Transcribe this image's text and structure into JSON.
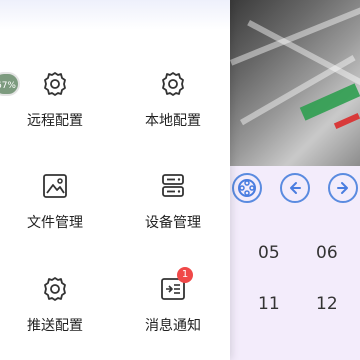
{
  "menu": {
    "items": [
      {
        "label": "远程配置",
        "icon": "gear-icon"
      },
      {
        "label": "本地配置",
        "icon": "gear-icon"
      },
      {
        "label": "文件管理",
        "icon": "image-file-icon"
      },
      {
        "label": "设备管理",
        "icon": "server-icon"
      },
      {
        "label": "推送配置",
        "icon": "gear-icon"
      },
      {
        "label": "消息通知",
        "icon": "message-icon",
        "badge": "1"
      }
    ],
    "avatar_badge": "67%"
  },
  "playback": {
    "channels": [
      "05",
      "06",
      "11",
      "12"
    ]
  },
  "colors": {
    "accent": "#4a7de0",
    "badge": "#f04848",
    "panel_bg": "#ffffff"
  }
}
